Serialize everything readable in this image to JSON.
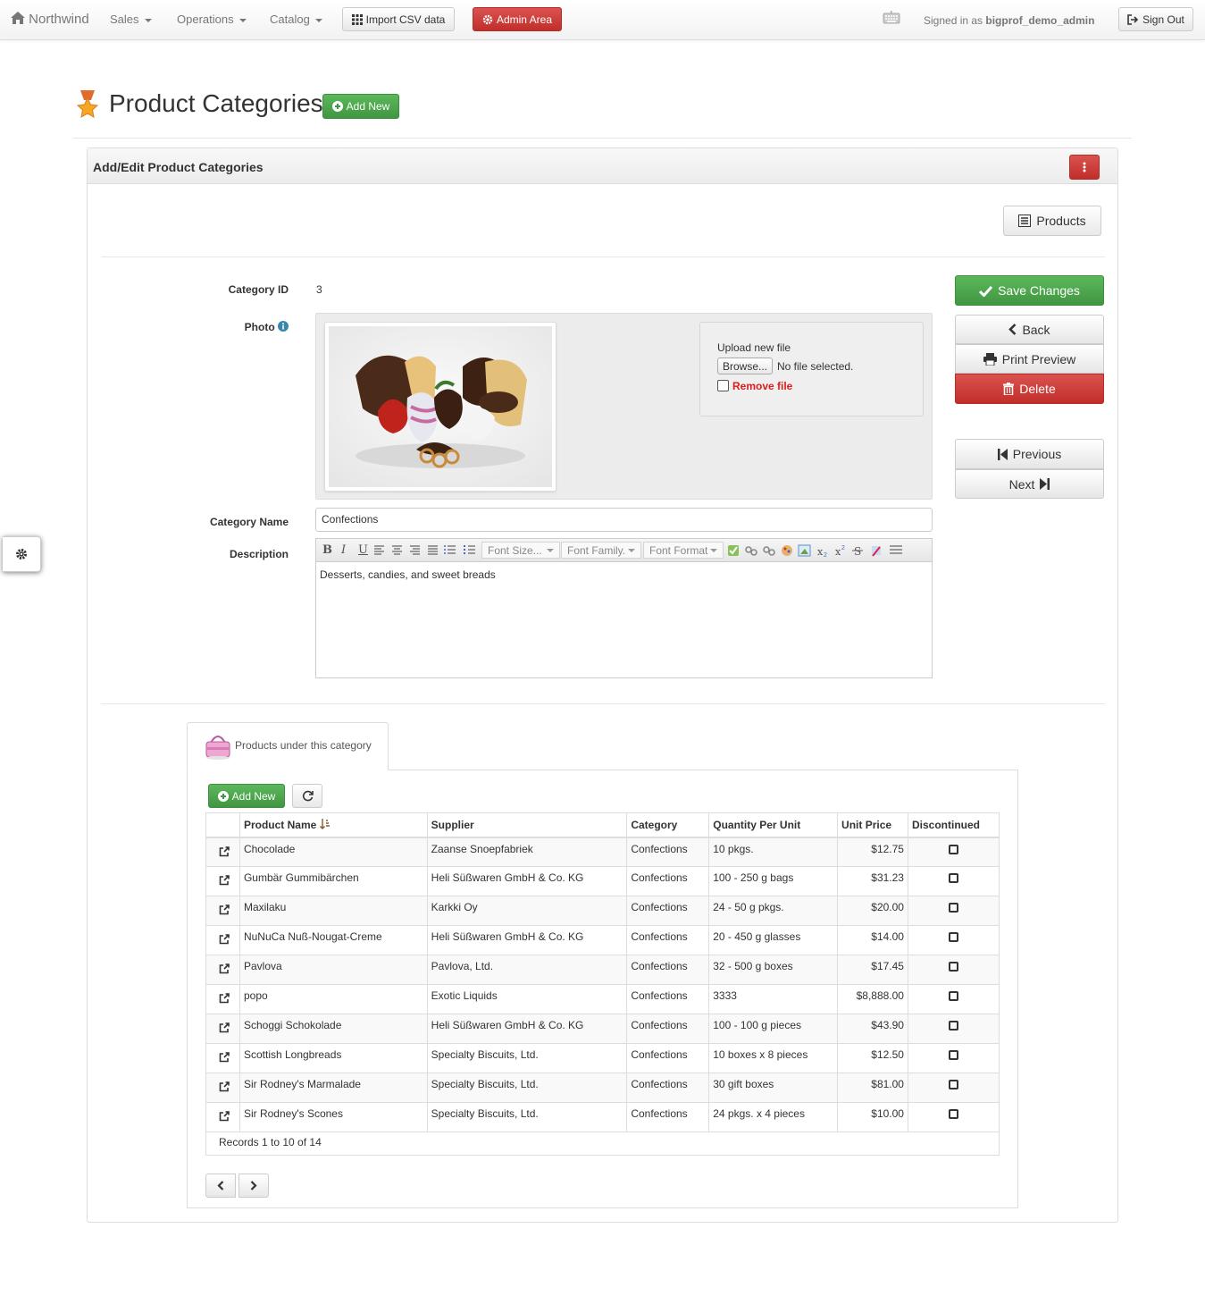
{
  "navbar": {
    "brand": "Northwind",
    "menus": [
      {
        "label": "Sales"
      },
      {
        "label": "Operations"
      },
      {
        "label": "Catalog"
      }
    ],
    "import_label": "Import CSV data",
    "admin_label": "Admin Area",
    "signed_in_prefix": "Signed in as",
    "username": "bigprof_demo_admin",
    "signout_label": "Sign Out"
  },
  "header": {
    "title": "Product Categories",
    "add_new_label": "Add New"
  },
  "panel": {
    "title": "Add/Edit Product Categories",
    "products_button": "Products"
  },
  "form": {
    "category_id_label": "Category ID",
    "category_id_value": "3",
    "photo_label": "Photo",
    "upload_label": "Upload new file",
    "browse_label": "Browse...",
    "no_file_label": "No file selected.",
    "remove_file_label": "Remove file",
    "category_name_label": "Category Name",
    "category_name_value": "Confections",
    "description_label": "Description",
    "description_value": "Desserts, candies, and sweet breads",
    "editor": {
      "font_size": "Font Size...",
      "font_family": "Font Family...",
      "font_format": "Font Format"
    }
  },
  "actions": {
    "save": "Save Changes",
    "back": "Back",
    "print": "Print Preview",
    "delete": "Delete",
    "previous": "Previous",
    "next": "Next"
  },
  "children": {
    "tab_label": "Products under this category",
    "add_new_label": "Add New",
    "columns": [
      "Product Name",
      "Supplier",
      "Category",
      "Quantity Per Unit",
      "Unit Price",
      "Discontinued"
    ],
    "rows": [
      [
        "Chocolade",
        "Zaanse Snoepfabriek",
        "Confections",
        "10 pkgs.",
        "$12.75"
      ],
      [
        "Gumbär Gummibärchen",
        "Heli Süßwaren GmbH & Co. KG",
        "Confections",
        "100 - 250 g bags",
        "$31.23"
      ],
      [
        "Maxilaku",
        "Karkki Oy",
        "Confections",
        "24 - 50 g pkgs.",
        "$20.00"
      ],
      [
        "NuNuCa Nuß-Nougat-Creme",
        "Heli Süßwaren GmbH & Co. KG",
        "Confections",
        "20 - 450 g glasses",
        "$14.00"
      ],
      [
        "Pavlova",
        "Pavlova, Ltd.",
        "Confections",
        "32 - 500 g boxes",
        "$17.45"
      ],
      [
        "popo",
        "Exotic Liquids",
        "Confections",
        "3333",
        "$8,888.00"
      ],
      [
        "Schoggi Schokolade",
        "Heli Süßwaren GmbH & Co. KG",
        "Confections",
        "100 - 100 g pieces",
        "$43.90"
      ],
      [
        "Scottish Longbreads",
        "Specialty Biscuits, Ltd.",
        "Confections",
        "10 boxes x 8 pieces",
        "$12.50"
      ],
      [
        "Sir Rodney's Marmalade",
        "Specialty Biscuits, Ltd.",
        "Confections",
        "30 gift boxes",
        "$81.00"
      ],
      [
        "Sir Rodney's Scones",
        "Specialty Biscuits, Ltd.",
        "Confections",
        "24 pkgs. x 4 pieces",
        "$10.00"
      ]
    ],
    "records_text": "Records 1 to 10 of 14"
  },
  "colors": {
    "danger": "#d9534f",
    "success": "#5cb85c",
    "navbar_text": "#777777"
  }
}
